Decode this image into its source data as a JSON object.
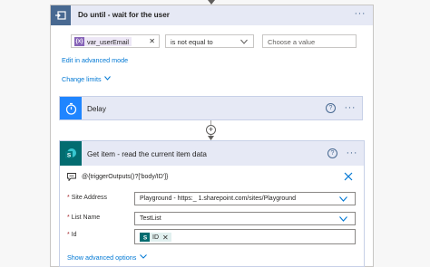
{
  "do_until": {
    "title": "Do until - wait for the user",
    "condition": {
      "left_token": "var_userEmail",
      "token_icon_text": "{x}",
      "operator": "is not equal to",
      "value_placeholder": "Choose a value"
    },
    "edit_advanced_label": "Edit in advanced mode",
    "change_limits_label": "Change limits"
  },
  "delay": {
    "title": "Delay"
  },
  "get_item": {
    "title": "Get item - read the current item data",
    "trigger_expression": "@{triggerOutputs()?['body/ID']}",
    "fields": {
      "site_address": {
        "label": "Site Address",
        "value": "Playground - https:_                       1.sharepoint.com/sites/Playground"
      },
      "list_name": {
        "label": "List Name",
        "value": "TestList"
      },
      "id": {
        "label": "Id",
        "token": "ID"
      }
    },
    "required_marker": "*",
    "show_advanced_label": "Show advanced options"
  },
  "icons": {
    "more": "more-dots-icon",
    "help": "help-icon",
    "close": "close-icon"
  },
  "colors": {
    "header_bg": "#e6e9f5",
    "until_icon": "#486991",
    "delay_icon": "#1f85ff",
    "sharepoint": "#036c70",
    "variable_token": "#8764b8",
    "link": "#0078d4"
  }
}
